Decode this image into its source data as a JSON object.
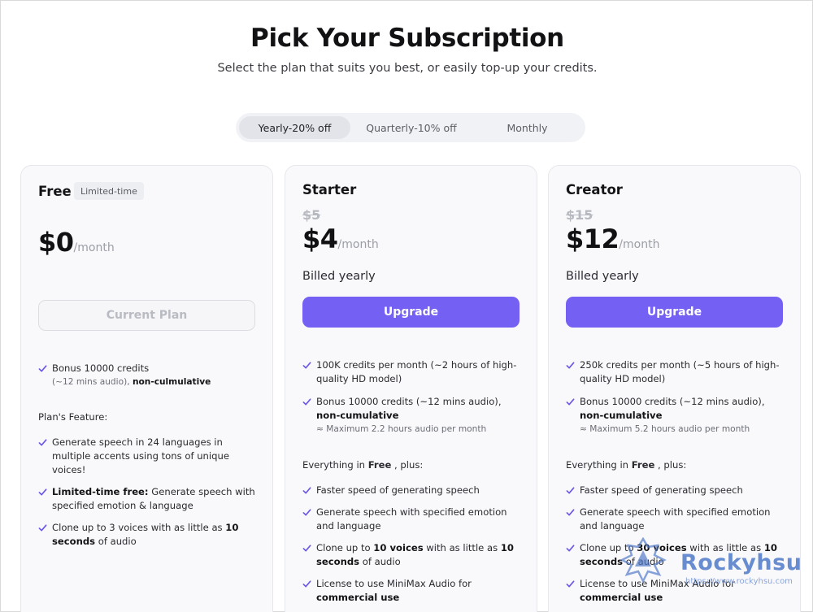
{
  "header": {
    "title": "Pick Your Subscription",
    "subtitle": "Select the plan that suits you best, or easily top-up your credits."
  },
  "billing_toggle": {
    "options": [
      "Yearly-20% off",
      "Quarterly-10% off",
      "Monthly"
    ],
    "selected": "Yearly-20% off"
  },
  "plans": [
    {
      "name": "Free",
      "badge": "Limited-time",
      "price": "$0",
      "per": "/month",
      "button": "Current Plan",
      "credits": {
        "line1": "Bonus 10000 credits",
        "line2_pre": "(~12 mins audio), ",
        "line2_bold": "non-culmulative"
      },
      "features_label": "Plan's Feature:",
      "features": {
        "f1": "Generate speech in 24 languages in multiple accents using tons of unique voices!",
        "f2_bold": "Limited-time free:",
        "f2_rest": " Generate speech with specified emotion & language",
        "f3_pre": "Clone up to 3 voices with as little as ",
        "f3_bold": "10 seconds",
        "f3_post": " of audio"
      }
    },
    {
      "name": "Starter",
      "old_price": "$5",
      "price": "$4",
      "per": "/month",
      "billed": "Billed yearly",
      "button": "Upgrade",
      "c1": "100K credits per month (~2 hours of high-quality HD model)",
      "c2_pre": "Bonus 10000 credits (~12 mins audio), ",
      "c2_bold": "non-cumulative",
      "c2_note": "≈ Maximum 2.2 hours audio per month",
      "everything_pre": "Everything in ",
      "everything_bold": "Free",
      "everything_post": " , plus:",
      "f1": "Faster speed of generating speech",
      "f2": "Generate speech with specified emotion and language",
      "f3_pre": "Clone up to ",
      "f3_bold1": "10 voices",
      "f3_mid": " with as little as ",
      "f3_bold2": "10 seconds",
      "f3_post": " of audio",
      "f4_pre": "License to use MiniMax Audio for ",
      "f4_bold": "commercial use"
    },
    {
      "name": "Creator",
      "old_price": "$15",
      "price": "$12",
      "per": "/month",
      "billed": "Billed yearly",
      "button": "Upgrade",
      "c1": "250k credits per month (~5 hours of high-quality HD model)",
      "c2_pre": "Bonus 10000 credits (~12 mins audio), ",
      "c2_bold": "non-cumulative",
      "c2_note": "≈ Maximum 5.2 hours audio per month",
      "everything_pre": "Everything in ",
      "everything_bold": "Free",
      "everything_post": " , plus:",
      "f1": "Faster speed of generating speech",
      "f2": "Generate speech with specified emotion and language",
      "f3_pre": "Clone up to ",
      "f3_bold1": "30 voices",
      "f3_mid": " with as little as ",
      "f3_bold2": "10 seconds",
      "f3_post": " of audio",
      "f4_pre": "License to use MiniMax Audio for ",
      "f4_bold": "commercial use"
    }
  ],
  "watermark": {
    "text": "Rockyhsu",
    "url": "https://www.rockyhsu.com"
  },
  "colors": {
    "accent": "#7560f4",
    "check": "#6a57e8",
    "card_bg": "#f9f9fb",
    "toggle_active": "#e2e4ea"
  }
}
